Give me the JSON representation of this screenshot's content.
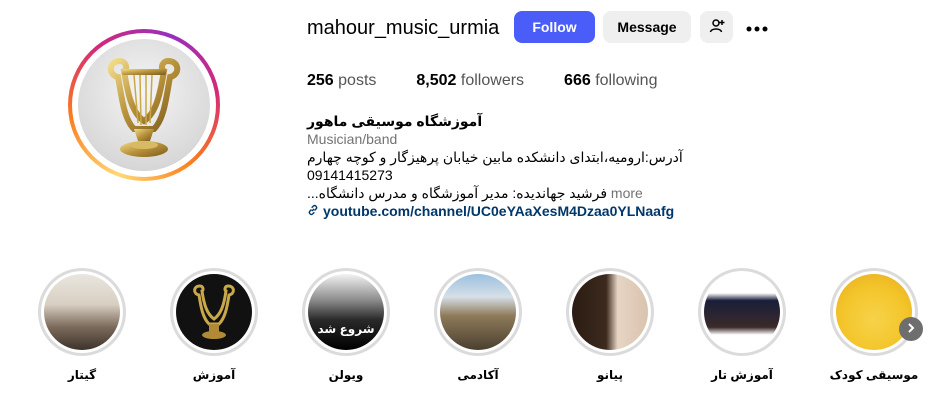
{
  "profile": {
    "username": "mahour_music_urmia",
    "follow_label": "Follow",
    "message_label": "Message",
    "stats": {
      "posts_count": "256",
      "posts_label": "posts",
      "followers_count": "8,502",
      "followers_label": "followers",
      "following_count": "666",
      "following_label": "following"
    },
    "bio": {
      "name": "آموزشگاه موسیقی ماهور",
      "category": "Musician/band",
      "address": "آدرس:ارومیه،ابتدای دانشکده مابین خیابان پرهیزگار و کوچه چهارم",
      "phone": "09141415273",
      "line3": "فرشید جهاندیده: مدیر آموزشگاه و مدرس دانشگاه...",
      "more_label": "more",
      "link": "youtube.com/channel/UC0eYAaXesM4Dzaa0YLNaafg"
    }
  },
  "highlights": [
    {
      "label": "گیتار"
    },
    {
      "label": "آموزش"
    },
    {
      "label": "ویولن",
      "overlay_text": "شروع شد"
    },
    {
      "label": "آکادمی"
    },
    {
      "label": "پیانو"
    },
    {
      "label": "آموزش تار"
    },
    {
      "label": "موسیقی کودک"
    }
  ],
  "colors": {
    "follow_button": "#4a5df9",
    "link": "#00376b",
    "secondary_button": "#efefef"
  },
  "icons": {
    "add_user": "add-user-icon",
    "more": "more-options-icon",
    "link": "link-icon",
    "next": "chevron-right-icon"
  }
}
